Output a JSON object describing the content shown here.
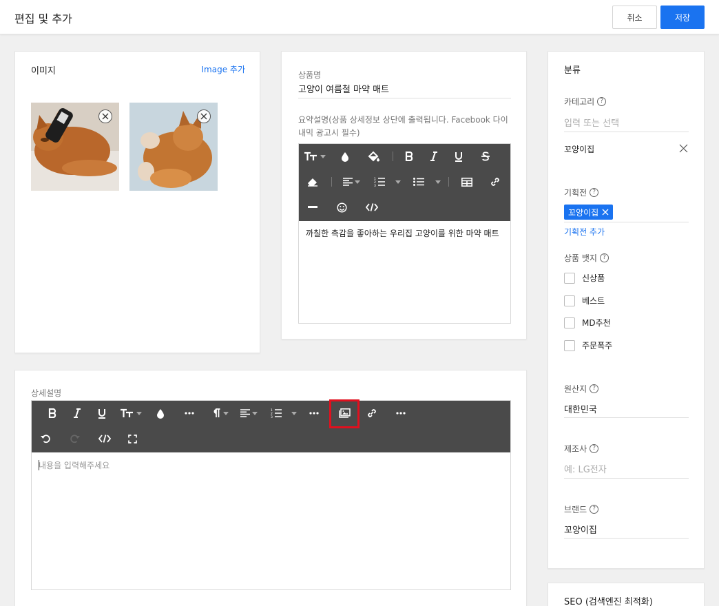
{
  "header": {
    "title": "편집 및 추가",
    "cancel_label": "취소",
    "save_label": "저장"
  },
  "image_section": {
    "label": "이미지",
    "add_label": "Image 추가"
  },
  "product": {
    "name_label": "상품명",
    "name_value": "고양이 여름철 마약 매트",
    "summary_label": "요약설명(상품 상세정보 상단에 출력됩니다. Facebook 다이내믹 광고시 필수)",
    "summary_content": "까칠한 촉감을 좋아하는 우리집 고양이를 위한 마약 매트"
  },
  "detail": {
    "label": "상세설명",
    "placeholder": "내용을 입력해주세요"
  },
  "classification": {
    "title": "분류",
    "category_label": "카테고리",
    "category_placeholder": "입력 또는 선택",
    "category_value": "꼬양이집",
    "promotion_label": "기획전",
    "promotion_tag": "꼬양이집",
    "promotion_add": "기획전 추가",
    "badge_label": "상품 뱃지",
    "badges": [
      "신상품",
      "베스트",
      "MD추천",
      "주문폭주"
    ],
    "origin_label": "원산지",
    "origin_value": "대한민국",
    "maker_label": "제조사",
    "maker_placeholder": "예: LG전자",
    "brand_label": "브랜드",
    "brand_value": "꼬양이집"
  },
  "seo": {
    "title": "SEO (검색엔진 최적화)"
  },
  "colors": {
    "accent": "#1a73f0",
    "toolbar": "#4a4a4a",
    "highlight": "#e0101e"
  }
}
